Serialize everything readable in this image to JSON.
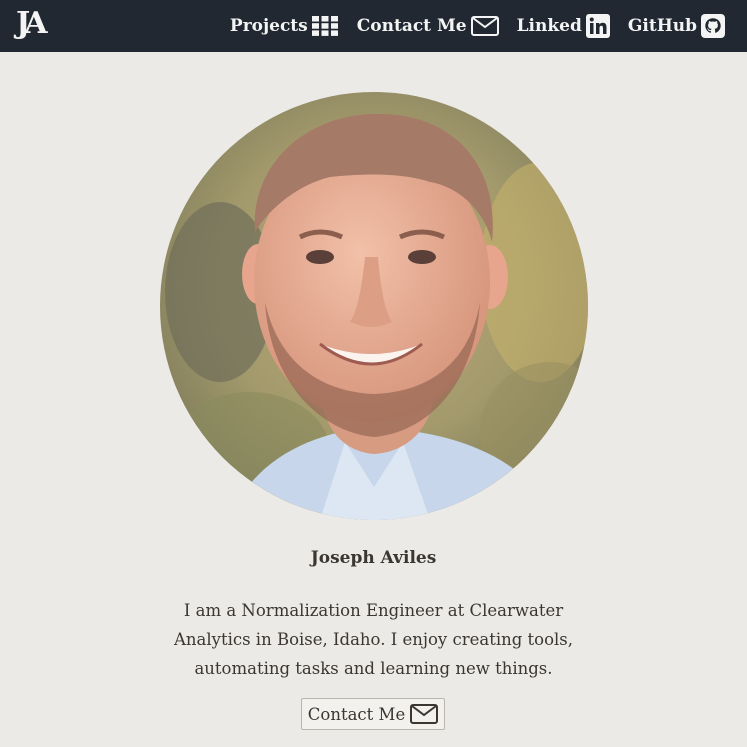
{
  "nav": {
    "logo_text": "JA",
    "links": [
      {
        "label": "Projects",
        "icon": "grid-icon"
      },
      {
        "label": "Contact Me",
        "icon": "envelope-icon"
      },
      {
        "label": "Linked",
        "icon": "linkedin-icon"
      },
      {
        "label": "GitHub",
        "icon": "github-icon"
      }
    ]
  },
  "profile": {
    "name": "Joseph Aviles",
    "bio": "I am a Normalization Engineer at Clearwater Analytics in Boise, Idaho. I enjoy creating tools, automating tasks and learning new things.",
    "contact_button_label": "Contact Me",
    "contact_button_icon": "envelope-icon"
  },
  "colors": {
    "navbar": "#212831",
    "page_background": "#ebeae6",
    "text": "#3b3632",
    "nav_text": "#f4f4f4"
  }
}
